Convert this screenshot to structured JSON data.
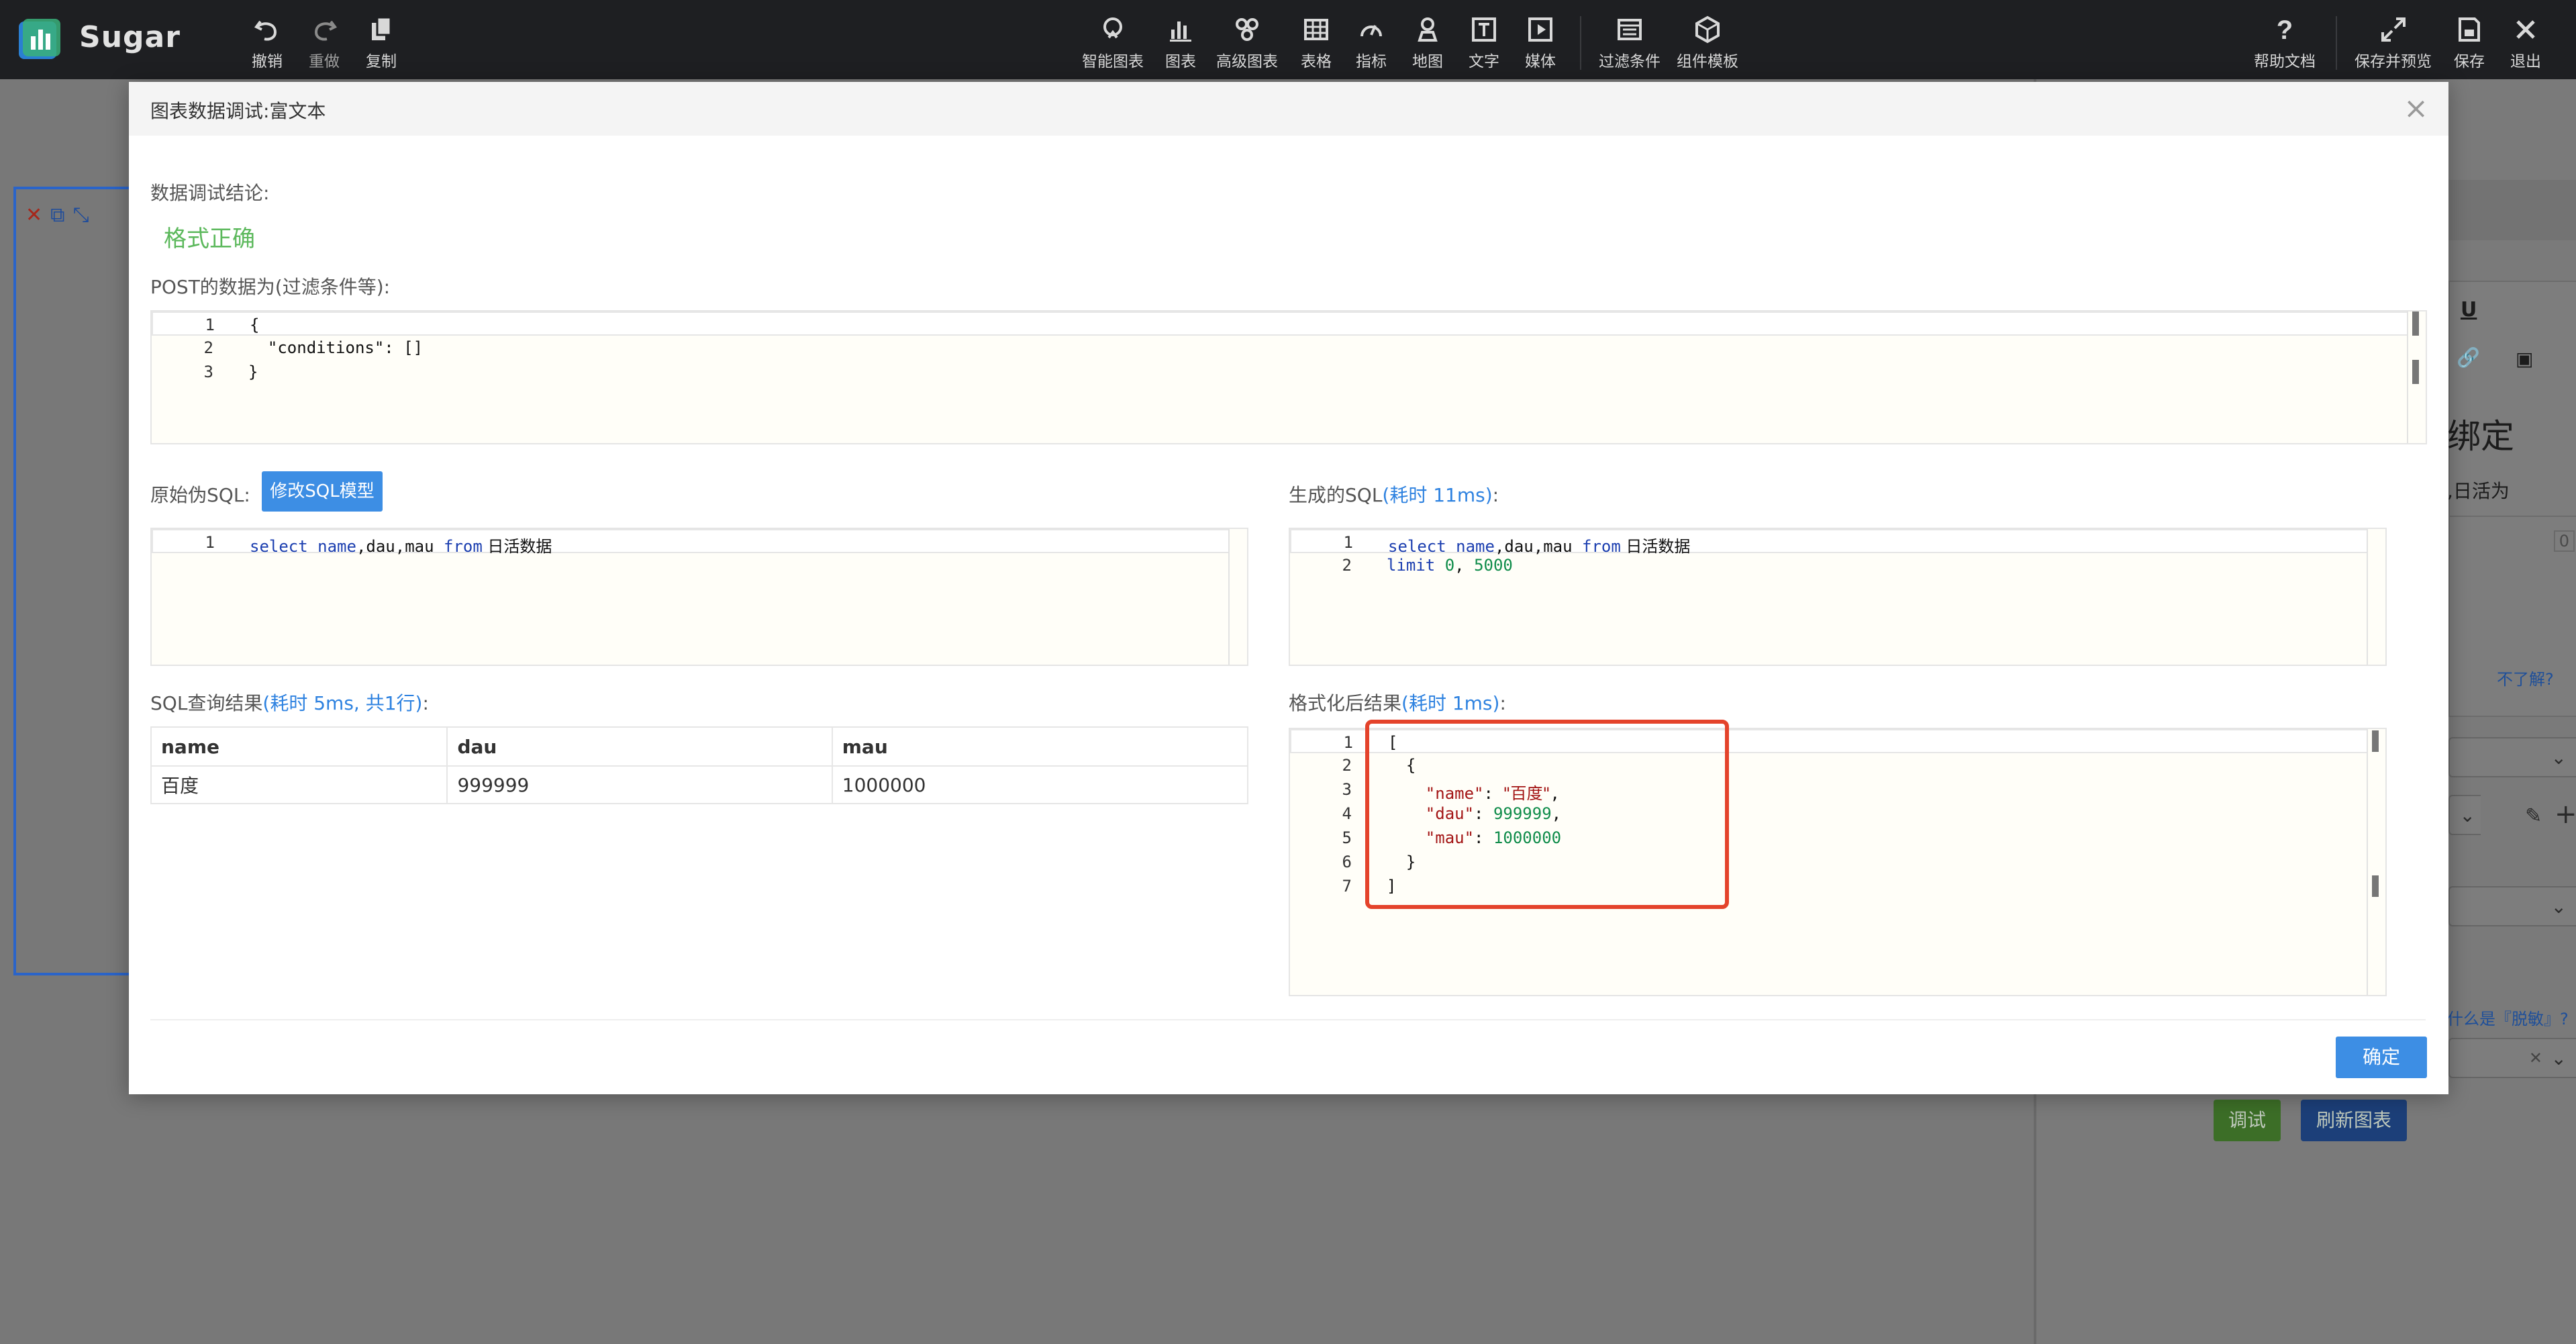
{
  "app": {
    "name": "Sugar"
  },
  "toolbar": {
    "undo": "撤销",
    "redo": "重做",
    "copy": "复制",
    "smart_chart": "智能图表",
    "chart": "图表",
    "advanced_chart": "高级图表",
    "table": "表格",
    "indicator": "指标",
    "map": "地图",
    "text": "文字",
    "media": "媒体",
    "filter": "过滤条件",
    "component_template": "组件模板",
    "help": "帮助文档",
    "save_preview": "保存并预览",
    "save": "保存",
    "exit": "退出"
  },
  "background": {
    "binding_title": "绑定",
    "daily_active": ",日活为",
    "zero": "0",
    "dont_understand": "不了解?",
    "what_is": "什么是『脱敏』?",
    "debug_button": "调试",
    "refresh_button": "刷新图表"
  },
  "modal": {
    "title": "图表数据调试:富文本",
    "conclusion_label": "数据调试结论:",
    "conclusion_value": "格式正确",
    "post_label": "POST的数据为(过滤条件等):",
    "post_code": [
      {
        "n": "1",
        "text": "{"
      },
      {
        "n": "2",
        "text": "  \"conditions\": []"
      },
      {
        "n": "3",
        "text": "}"
      }
    ],
    "raw_sql_label": "原始伪SQL:",
    "edit_sql_button": "修改SQL模型",
    "raw_sql_line_no": "1",
    "raw_sql": {
      "k1": "select",
      "f1": "name",
      "rest": ",dau,mau ",
      "k2": "from",
      "table": " 日活数据"
    },
    "gen_sql_label": "生成的SQL",
    "gen_sql_time": "(耗时 11ms)",
    "gen_sql_colon": ":",
    "gen_sql_line1_no": "1",
    "gen_sql_line2_no": "2",
    "gen_sql_line1": {
      "k1": "select",
      "f1": "name",
      "rest": ",dau,mau ",
      "k2": "from",
      "table": " 日活数据"
    },
    "gen_sql_line2": {
      "k": "limit",
      "a": "0",
      "b": "5000"
    },
    "query_label": "SQL查询结果",
    "query_time": "(耗时 5ms, 共1行)",
    "query_colon": ":",
    "table": {
      "headers": [
        "name",
        "dau",
        "mau"
      ],
      "rows": [
        [
          "百度",
          "999999",
          "1000000"
        ]
      ]
    },
    "format_label": "格式化后结果",
    "format_time": "(耗时 1ms)",
    "format_colon": ":",
    "format_lines": [
      "1",
      "2",
      "3",
      "4",
      "5",
      "6",
      "7"
    ],
    "format_json": {
      "name_key": "\"name\"",
      "name_val": "\"百度\"",
      "dau_key": "\"dau\"",
      "dau_val": "999999",
      "mau_key": "\"mau\"",
      "mau_val": "1000000"
    },
    "confirm_button": "确定"
  }
}
